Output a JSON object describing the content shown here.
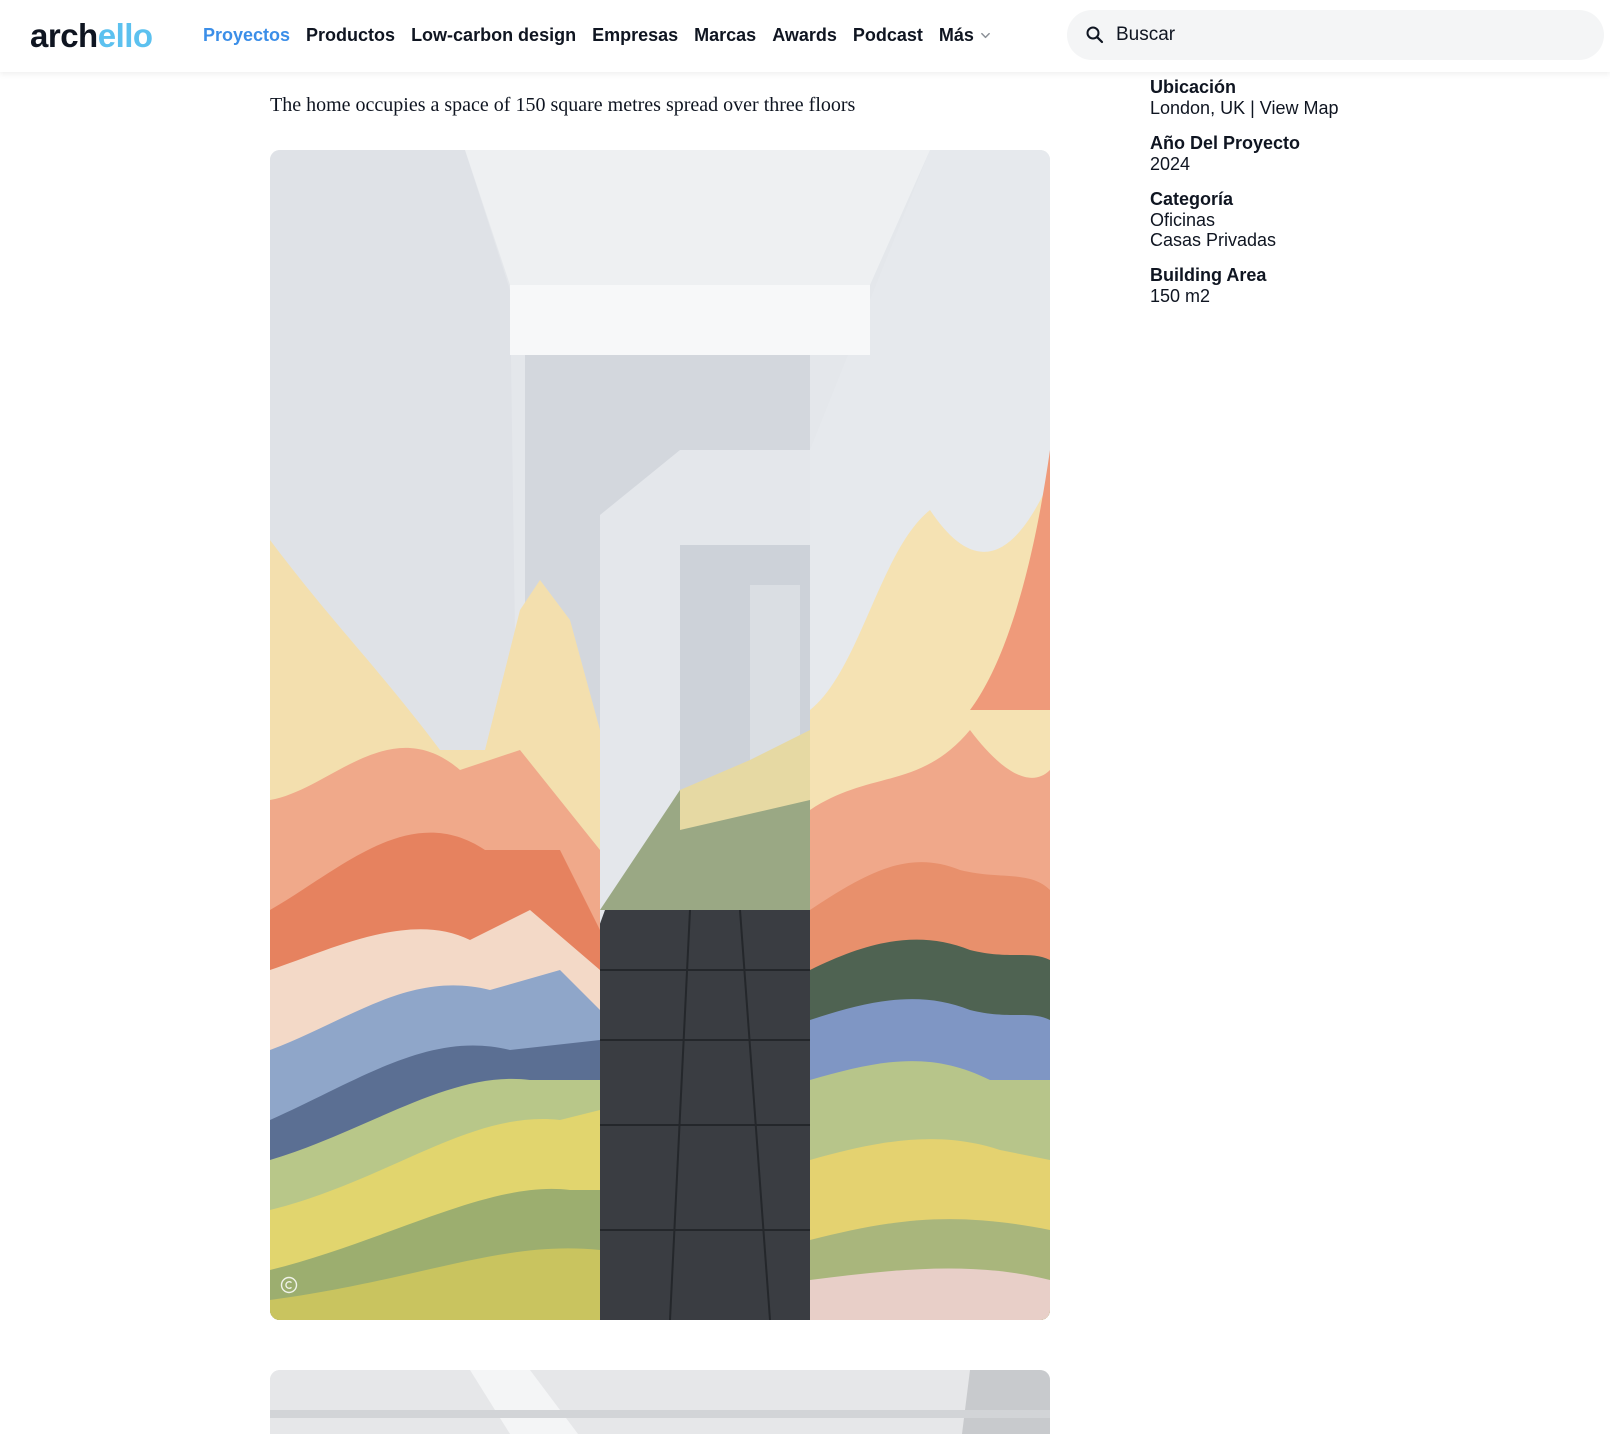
{
  "header": {
    "logo_part1": "arch",
    "logo_part2": "ello",
    "nav": [
      {
        "label": "Proyectos"
      },
      {
        "label": "Productos"
      },
      {
        "label": "Low-carbon design"
      },
      {
        "label": "Empresas"
      },
      {
        "label": "Marcas"
      },
      {
        "label": "Awards"
      },
      {
        "label": "Podcast"
      },
      {
        "label": "Más"
      }
    ],
    "search": {
      "placeholder": "Buscar",
      "icon": "search-icon"
    },
    "colors": {
      "brand_dark": "#0f1521",
      "brand_light": "#5cc1ef",
      "active_nav": "#3b8ee8"
    }
  },
  "article": {
    "caption": "The home occupies a space of 150 square metres spread over three floors"
  },
  "details": {
    "location_label": "Ubicación",
    "location_value": "London, UK",
    "separator": " | ",
    "view_map_label": "View Map",
    "year_label": "Año Del Proyecto",
    "year_value": "2024",
    "category_label": "Categoría",
    "categories": [
      "Oficinas",
      "Casas Privadas"
    ],
    "area_label": "Building Area",
    "area_value": "150 m2"
  }
}
